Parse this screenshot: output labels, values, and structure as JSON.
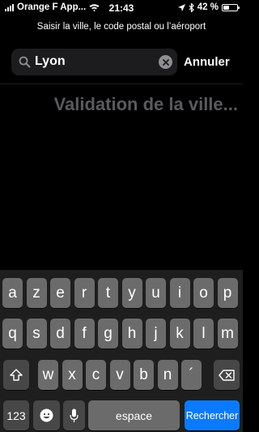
{
  "status_bar": {
    "carrier": "Orange F App...",
    "time": "21:43",
    "battery_percent": "42 %",
    "battery_level": 0.42,
    "icons": [
      "signal-icon",
      "wifi-icon",
      "location-arrow-icon",
      "bluetooth-icon",
      "battery-icon"
    ]
  },
  "prompt": "Saisir la ville, le code postal ou l’aéroport",
  "search": {
    "value": "Lyon",
    "cancel_label": "Annuler"
  },
  "status_message": "Validation de la ville...",
  "keyboard": {
    "row1": [
      "a",
      "z",
      "e",
      "r",
      "t",
      "y",
      "u",
      "i",
      "o",
      "p"
    ],
    "row2": [
      "q",
      "s",
      "d",
      "f",
      "g",
      "h",
      "j",
      "k",
      "l",
      "m"
    ],
    "row3": [
      "w",
      "x",
      "c",
      "v",
      "b",
      "n",
      "´"
    ],
    "numbers_label": "123",
    "space_label": "espace",
    "return_label": "Rechercher",
    "icons": [
      "shift-icon",
      "backspace-icon",
      "emoji-icon",
      "microphone-icon"
    ]
  },
  "colors": {
    "background": "#000000",
    "key": "#6b6b6b",
    "special_key": "#474747",
    "return_key": "#0a7bff",
    "placeholder_text": "#5a5a5e"
  }
}
